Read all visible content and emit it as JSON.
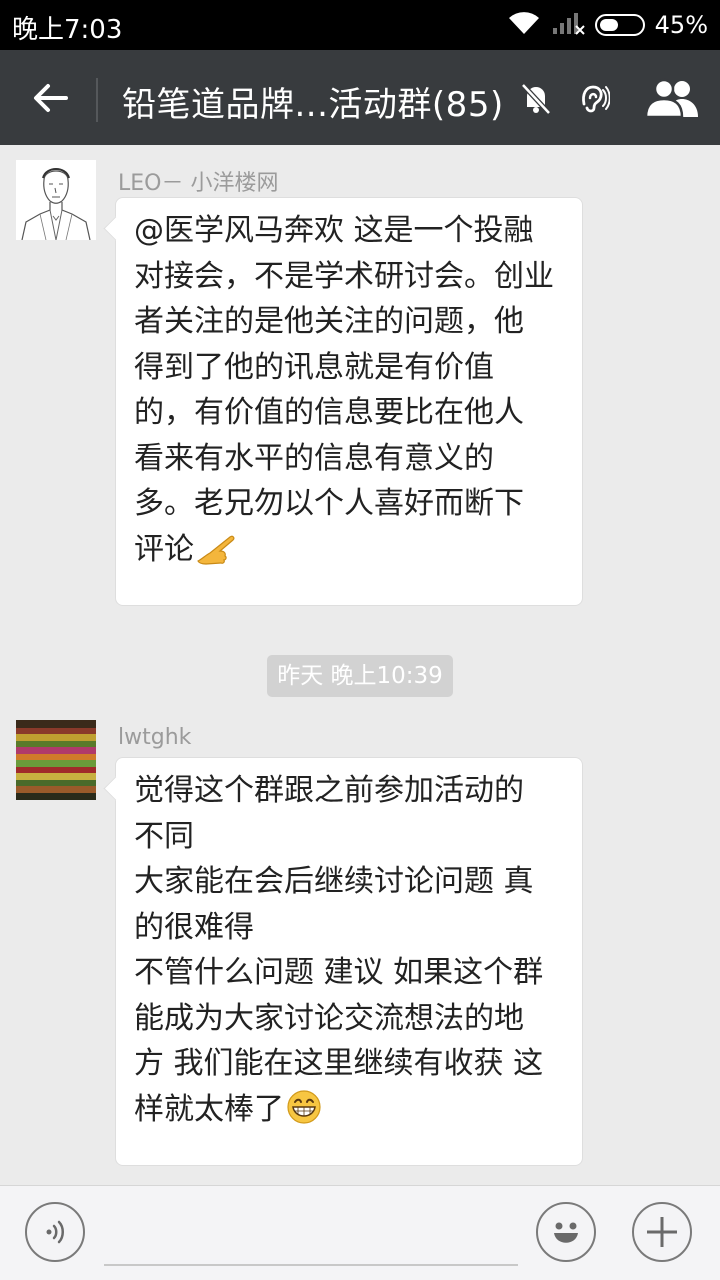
{
  "status_bar": {
    "time": "晚上7:03",
    "battery_percent": "45%",
    "battery_level": 0.45
  },
  "header": {
    "title": "铅笔道品牌...活动群(85)",
    "icons": [
      "back-arrow-icon",
      "mute-bell-icon",
      "earpiece-icon",
      "group-members-icon"
    ]
  },
  "messages": [
    {
      "sender": "LEO－ 小洋楼网",
      "avatar": "sketch-portrait-avatar",
      "text": "@医学风马奔欢 这是一个投融\n对接会，不是学术研讨会。创业\n者关注的是他关注的问题，他\n得到了他的讯息就是有价值\n的，有价值的信息要比在他人\n看来有水平的信息有意义的\n多。老兄勿以个人喜好而断下\n评论",
      "emoji": "pointing-hand-emoji"
    },
    {
      "sender": "lwtghk",
      "avatar": "striped-pattern-avatar",
      "text": "觉得这个群跟之前参加活动的\n不同\n大家能在会后继续讨论问题 真\n的很难得\n不管什么问题 建议 如果这个群\n能成为大家讨论交流想法的地\n方 我们能在这里继续有收获 这\n样就太棒了",
      "emoji": "grinning-face-emoji"
    }
  ],
  "timestamp": "昨天 晚上10:39",
  "input_bar": {
    "icons": [
      "voice-icon",
      "emoji-icon",
      "plus-icon"
    ]
  },
  "colors": {
    "header_bg": "#383b3e",
    "chat_bg": "#ebebeb",
    "bubble_bg": "#ffffff"
  }
}
